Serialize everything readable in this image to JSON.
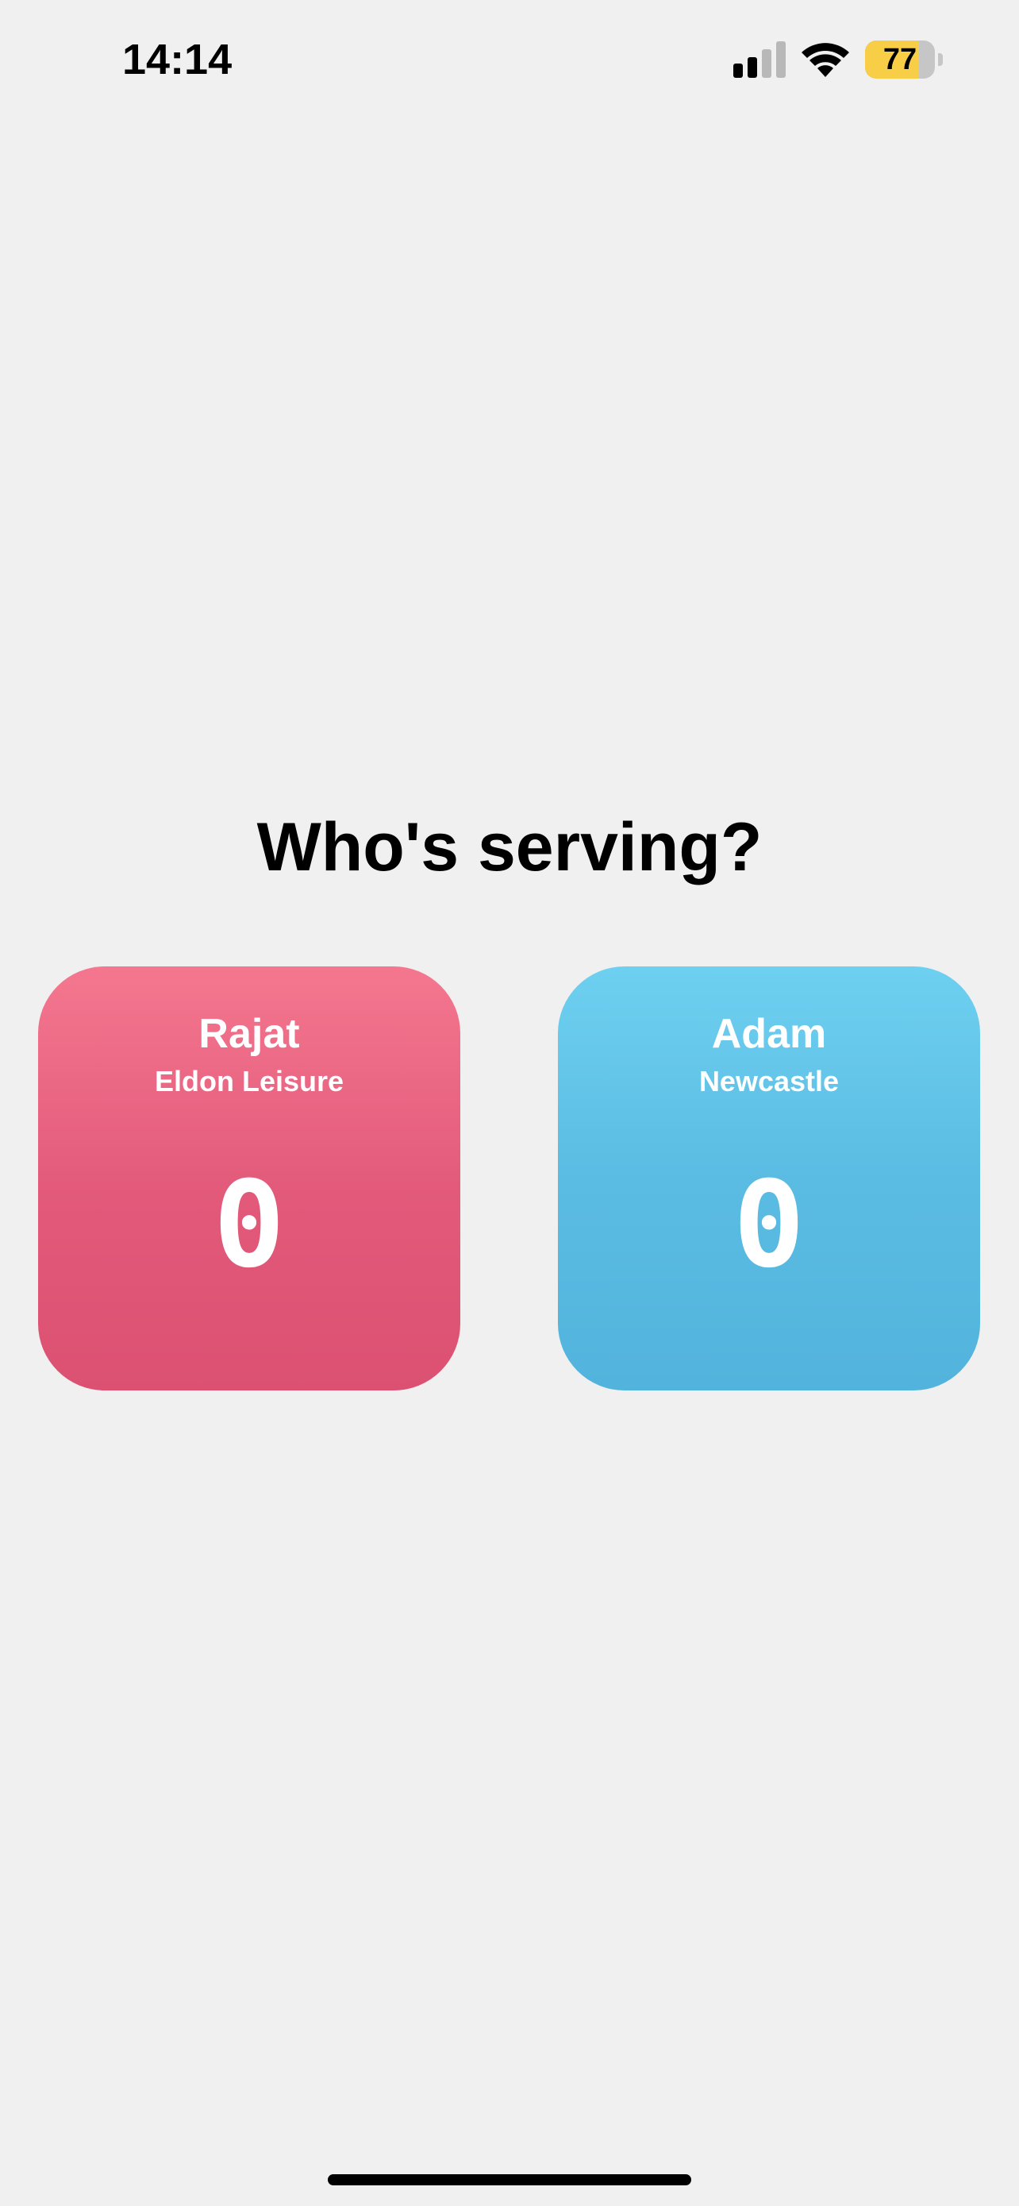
{
  "status_bar": {
    "time": "14:14",
    "battery_level": "77",
    "battery_fraction": 0.77,
    "icons": [
      "signal-icon",
      "wifi-icon",
      "battery-icon"
    ]
  },
  "prompt": {
    "title": "Who's serving?"
  },
  "players": [
    {
      "name": "Rajat",
      "club": "Eldon Leisure",
      "score": "0",
      "color": "#e2597a"
    },
    {
      "name": "Adam",
      "club": "Newcastle",
      "score": "0",
      "color": "#5bbce3"
    }
  ]
}
